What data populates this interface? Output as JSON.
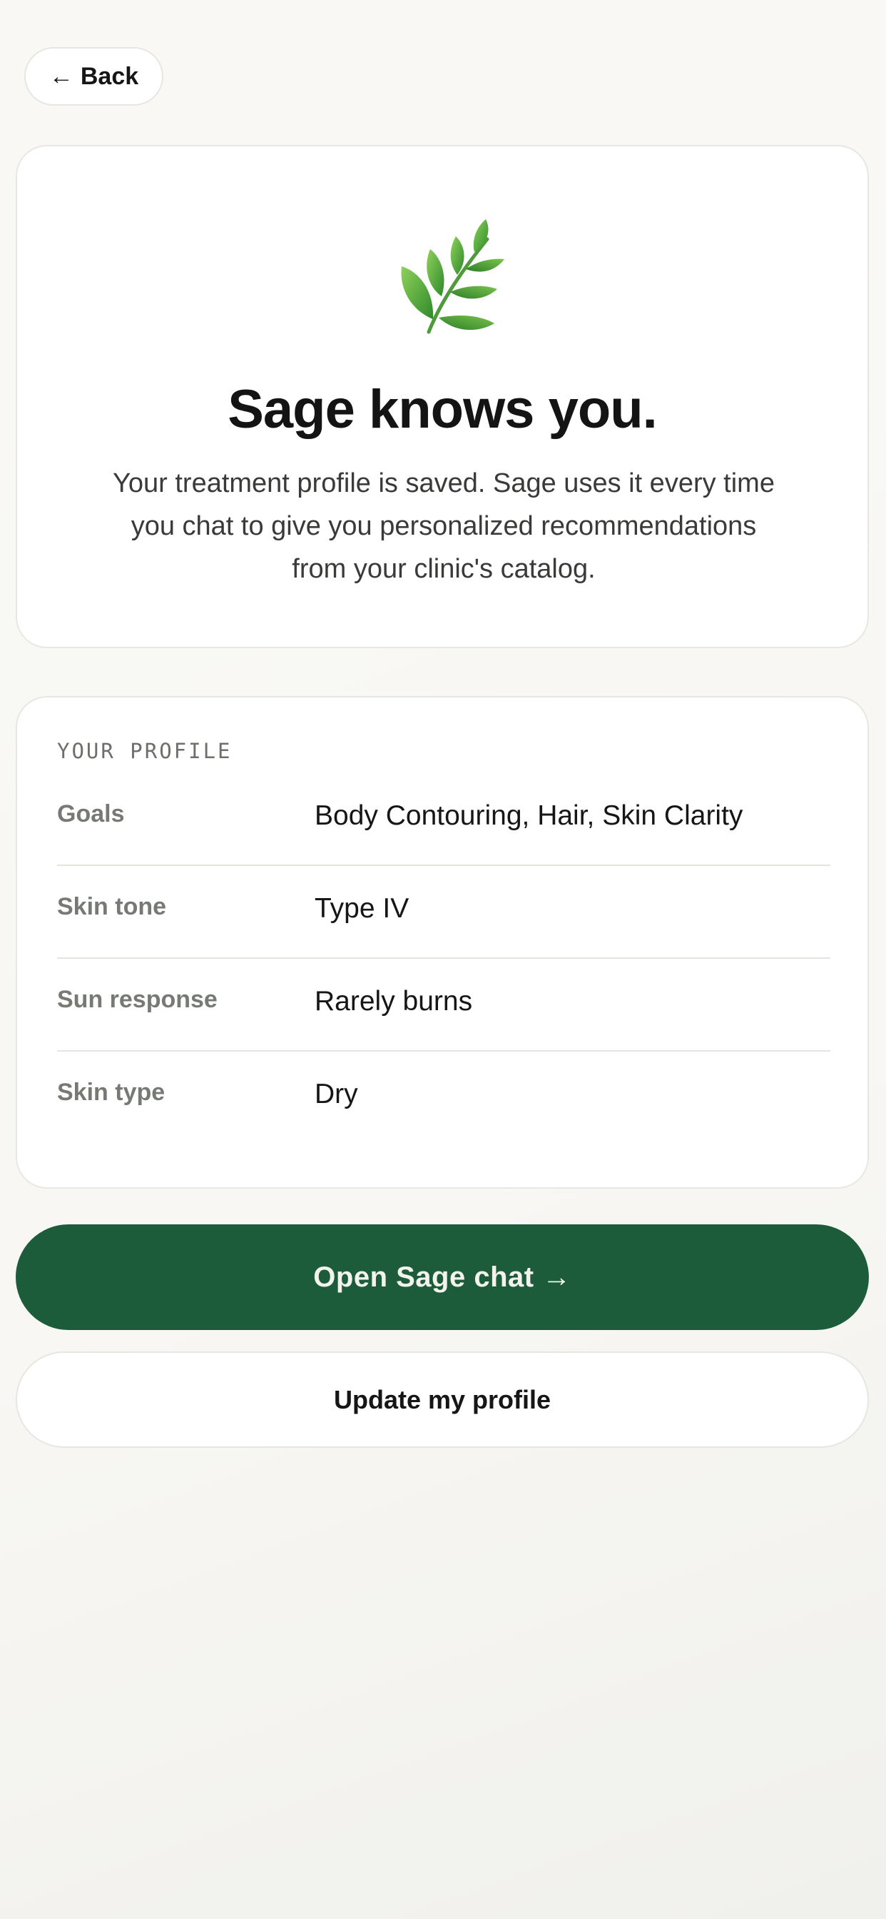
{
  "header": {
    "back_arrow": "←",
    "back_label": "Back",
    "back_icon": "arrow-left-icon"
  },
  "hero": {
    "icon": "herb-leaf-icon",
    "title": "Sage knows you.",
    "description": "Your treatment profile is saved. Sage uses it every time you chat to give you personalized recommendations from your clinic's catalog."
  },
  "profile": {
    "heading": "YOUR PROFILE",
    "rows": [
      {
        "label": "Goals",
        "value": "Body Contouring, Hair, Skin Clarity"
      },
      {
        "label": "Skin tone",
        "value": "Type IV"
      },
      {
        "label": "Sun response",
        "value": "Rarely burns"
      },
      {
        "label": "Skin type",
        "value": "Dry"
      }
    ]
  },
  "actions": {
    "primary_label": "Open Sage chat →",
    "secondary_label": "Update my profile"
  },
  "colors": {
    "accent_green": "#1d5c3b",
    "background": "#f8f7f4",
    "card": "#ffffff",
    "muted_text": "#777a74"
  }
}
